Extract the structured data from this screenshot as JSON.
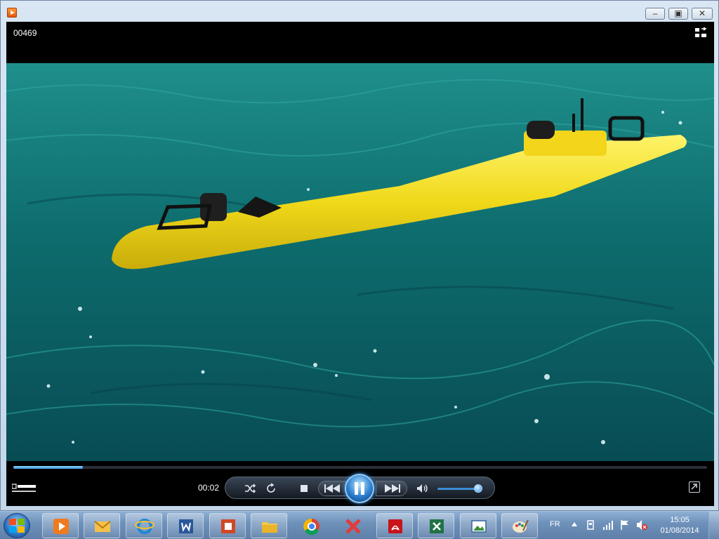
{
  "window": {
    "title": "",
    "buttons": {
      "minimize": "–",
      "maximize": "▣",
      "close": "✕"
    }
  },
  "player": {
    "media_title": "00469",
    "elapsed_time": "00:02",
    "progress_fraction": 0.1,
    "volume_fraction": 0.9,
    "icons": [
      "fullscreen-toggle-icon",
      "dolby-logo",
      "shuffle-icon",
      "repeat-icon",
      "stop-icon",
      "previous-icon",
      "pause-icon",
      "next-icon",
      "speaker-icon",
      "switch-to-library-icon"
    ],
    "colors": {
      "accent": "#3c8fd8",
      "video_water": "#0f6f6e",
      "vehicle": "#f2e11c"
    }
  },
  "taskbar": {
    "apps": [
      "windows-media-player",
      "mail",
      "internet-explorer",
      "microsoft-word",
      "microsoft-powerpoint",
      "file-explorer",
      "google-chrome",
      "app-red-x",
      "adobe-reader",
      "microsoft-excel",
      "photo-viewer",
      "paint"
    ],
    "tray": {
      "language": "FR",
      "time": "15:05",
      "date": "01/08/2014"
    }
  }
}
